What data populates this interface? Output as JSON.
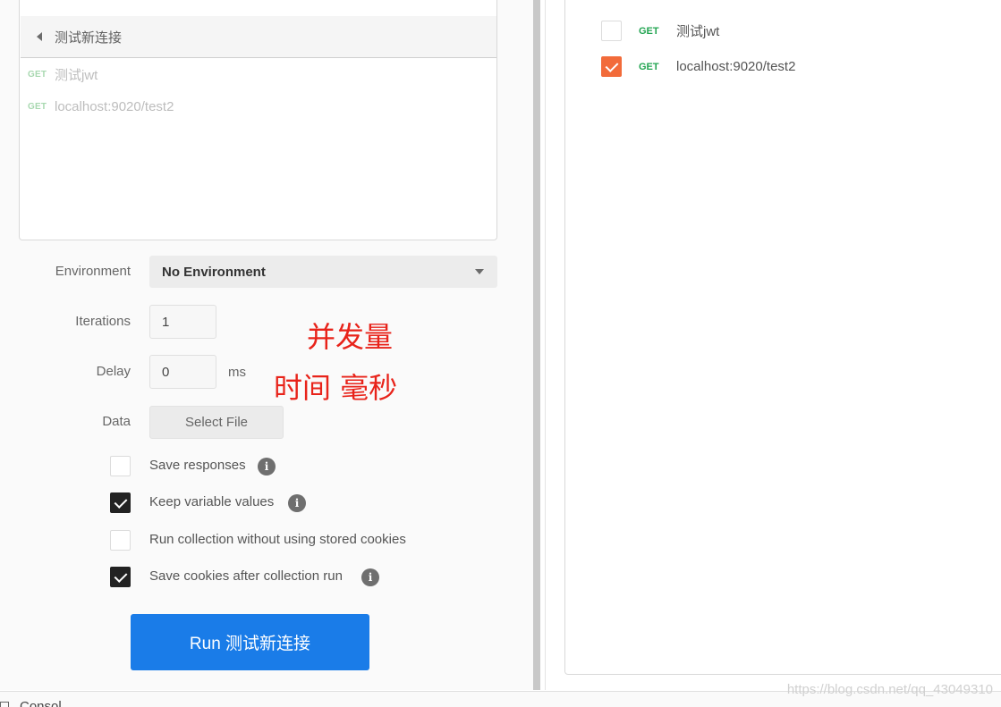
{
  "collection": {
    "name": "测试新连接",
    "requests": [
      {
        "method": "GET",
        "name": "测试jwt"
      },
      {
        "method": "GET",
        "name": "localhost:9020/test2"
      }
    ]
  },
  "form": {
    "environment_label": "Environment",
    "environment_value": "No Environment",
    "iterations_label": "Iterations",
    "iterations_value": "1",
    "delay_label": "Delay",
    "delay_value": "0",
    "delay_unit": "ms",
    "data_label": "Data",
    "select_file_label": "Select File"
  },
  "options": [
    {
      "label": "Save responses",
      "checked": false,
      "info": true
    },
    {
      "label": "Keep variable values",
      "checked": true,
      "info": true
    },
    {
      "label": "Run collection without using stored cookies",
      "checked": false,
      "info": false
    },
    {
      "label": "Save cookies after collection run",
      "checked": true,
      "info": true
    }
  ],
  "run_button_label": "Run 测试新连接",
  "annotations": {
    "concurrency": "并发量",
    "time_ms": "时间 毫秒"
  },
  "run_order": [
    {
      "method": "GET",
      "name": "测试jwt",
      "checked": false
    },
    {
      "method": "GET",
      "name": "localhost:9020/test2",
      "checked": true
    }
  ],
  "footer": {
    "text": "Consol",
    "watermark": "https://blog.csdn.net/qq_43049310"
  },
  "colors": {
    "run_button": "#1a7ce8",
    "checkbox_dark": "#222222",
    "checkbox_orange": "#f26b3a",
    "get_method_green": "#23a552",
    "annotation_red": "#e8231a"
  },
  "icons": {
    "back": "caret-left-icon",
    "dropdown": "caret-down-icon",
    "info": "info-icon",
    "check": "check-icon"
  }
}
